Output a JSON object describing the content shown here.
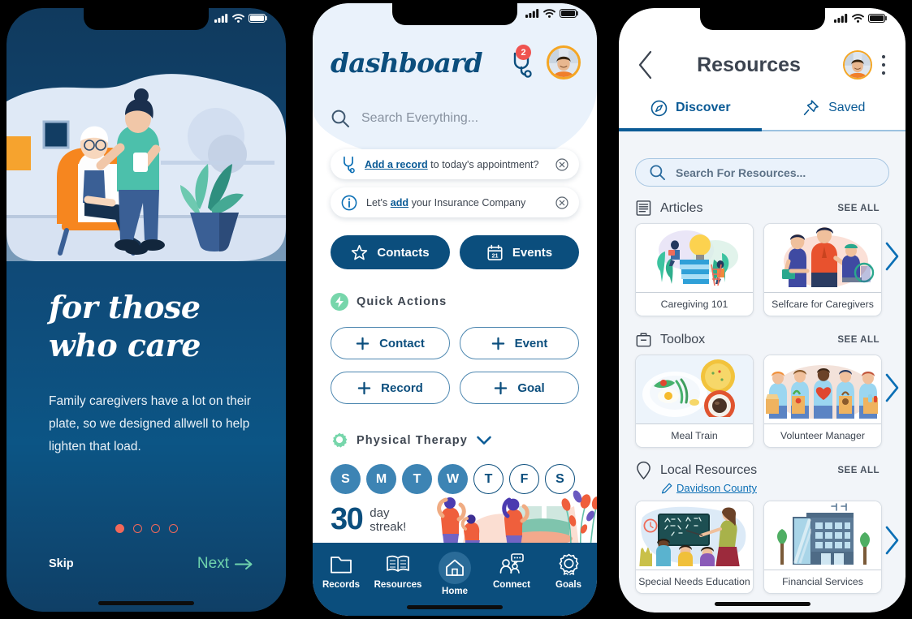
{
  "theme": {
    "navy": "#0b4e7d",
    "link_blue": "#0b6fb5",
    "accent_orange": "#f5a623",
    "coral": "#f2685a",
    "mint": "#77d6ab",
    "next_green": "#6fd3ad"
  },
  "phone1": {
    "name": "onboarding-screen",
    "status": {
      "signal": "signal-icon",
      "wifi": "wifi-icon",
      "battery": "battery-icon"
    },
    "illustration": "caregiver-with-senior-illustration",
    "title_line1": "for those",
    "title_line2": "who care",
    "body": "Family caregivers have a lot on their plate, so we designed allwell to help lighten that load.",
    "pagination": {
      "total": 4,
      "active_index": 0
    },
    "skip_label": "Skip",
    "next_label": "Next",
    "next_icon": "arrow-right-icon"
  },
  "phone2": {
    "name": "dashboard-screen",
    "status": {
      "signal": "signal-icon",
      "wifi": "wifi-icon",
      "battery": "battery-icon"
    },
    "logo": "dashboard",
    "notification": {
      "icon": "stethoscope-icon",
      "count": "2"
    },
    "avatar": "user-avatar",
    "search": {
      "icon": "search-icon",
      "placeholder": "Search Everything..."
    },
    "notices": [
      {
        "icon": "stethoscope-icon",
        "link": "Add a record",
        "rest": " to today's appointment?",
        "close": "close-circle-icon"
      },
      {
        "icon": "info-circle-icon",
        "pre": "Let's ",
        "link": "add",
        "rest": " your Insurance Company",
        "close": "close-circle-icon"
      }
    ],
    "primary_buttons": [
      {
        "icon": "star-icon",
        "label": "Contacts"
      },
      {
        "icon": "calendar-icon",
        "label": "Events"
      }
    ],
    "quick_actions": {
      "icon": "lightning-bolt-icon",
      "title": "Quick Actions",
      "buttons": [
        {
          "icon": "plus-icon",
          "label": "Contact"
        },
        {
          "icon": "plus-icon",
          "label": "Event"
        },
        {
          "icon": "plus-icon",
          "label": "Record"
        },
        {
          "icon": "plus-icon",
          "label": "Goal"
        }
      ]
    },
    "therapy": {
      "icon": "gear-icon",
      "title": "Physical Therapy",
      "chevron": "chevron-down-icon",
      "days": [
        {
          "letter": "S",
          "done": true
        },
        {
          "letter": "M",
          "done": true
        },
        {
          "letter": "T",
          "done": true
        },
        {
          "letter": "W",
          "done": true
        },
        {
          "letter": "T",
          "done": false
        },
        {
          "letter": "F",
          "done": false
        },
        {
          "letter": "S",
          "done": false
        }
      ],
      "streak_number": "30",
      "streak_label_line1": "day",
      "streak_label_line2": "streak!",
      "illustration": "people-stretching-illustration"
    },
    "tabbar": [
      {
        "icon": "folder-icon",
        "label": "Records",
        "active": false
      },
      {
        "icon": "book-icon",
        "label": "Resources",
        "active": false
      },
      {
        "icon": "home-icon",
        "label": "Home",
        "active": true
      },
      {
        "icon": "people-chat-icon",
        "label": "Connect",
        "active": false
      },
      {
        "icon": "award-icon",
        "label": "Goals",
        "active": false
      }
    ]
  },
  "phone3": {
    "name": "resources-screen",
    "status": {
      "signal": "signal-icon",
      "wifi": "wifi-icon",
      "battery": "battery-icon"
    },
    "back_icon": "chevron-left-icon",
    "title": "Resources",
    "avatar": "user-avatar",
    "menu_icon": "kebab-menu-icon",
    "tabs": [
      {
        "icon": "compass-icon",
        "label": "Discover",
        "active": true
      },
      {
        "icon": "pin-icon",
        "label": "Saved",
        "active": false
      }
    ],
    "search": {
      "icon": "search-icon",
      "placeholder": "Search For Resources..."
    },
    "sections": [
      {
        "icon": "article-icon",
        "title": "Articles",
        "see_all": "SEE ALL",
        "cards": [
          {
            "caption": "Caregiving 101",
            "art": "lightbulb-books-illustration"
          },
          {
            "caption": "Selfcare for Caregivers",
            "art": "caregiver-group-illustration"
          }
        ],
        "next_icon": "chevron-right-icon"
      },
      {
        "icon": "toolbox-icon",
        "title": "Toolbox",
        "see_all": "SEE ALL",
        "cards": [
          {
            "caption": "Meal Train",
            "art": "meal-plate-illustration"
          },
          {
            "caption": "Volunteer Manager",
            "art": "volunteers-illustration"
          }
        ],
        "next_icon": "chevron-right-icon"
      },
      {
        "icon": "location-pin-icon",
        "title": "Local Resources",
        "see_all": "SEE ALL",
        "sublink": {
          "icon": "edit-pencil-icon",
          "label": "Davidson County"
        },
        "cards": [
          {
            "caption": "Special Needs Education",
            "art": "classroom-illustration"
          },
          {
            "caption": "Financial Services",
            "art": "office-building-illustration"
          }
        ],
        "next_icon": "chevron-right-icon"
      }
    ]
  }
}
